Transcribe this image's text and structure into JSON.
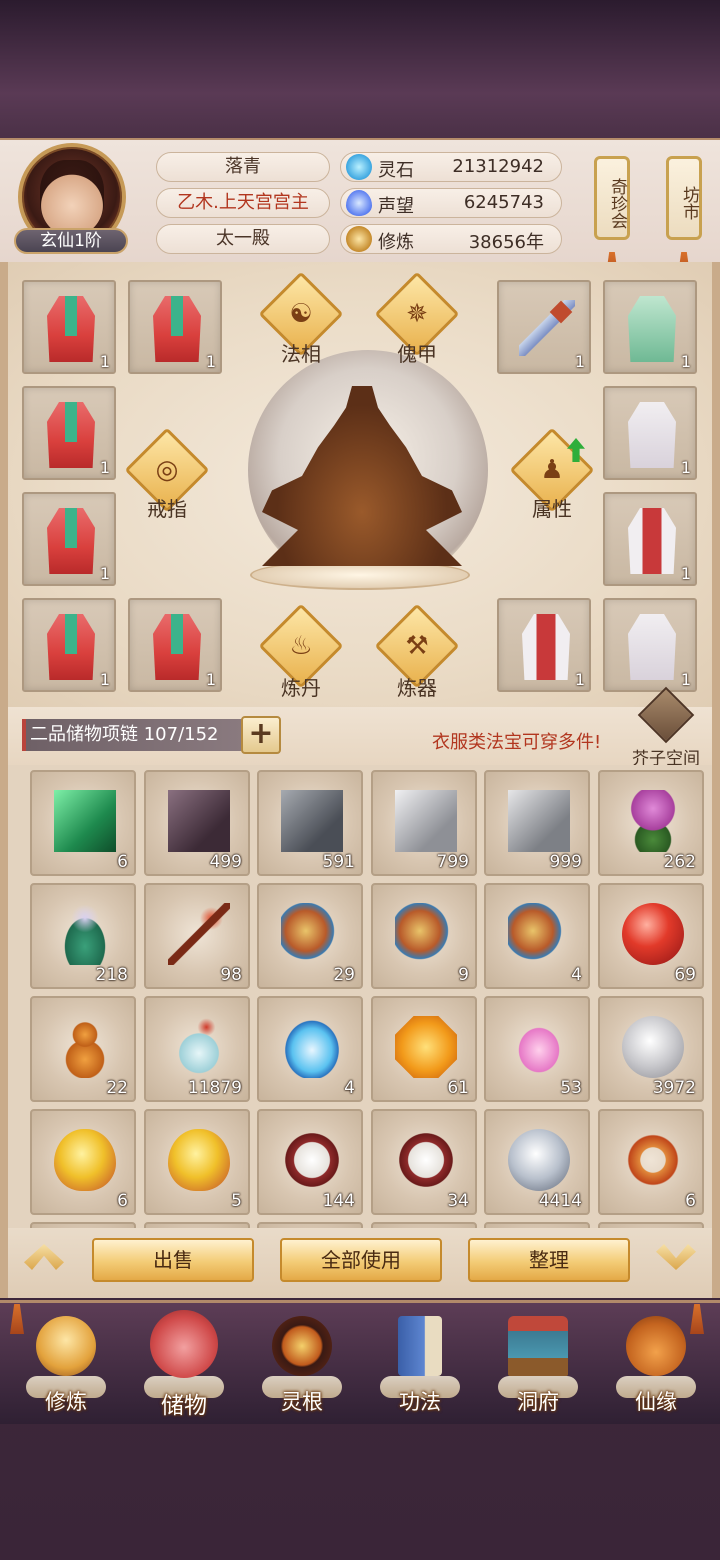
{
  "player": {
    "rank": "玄仙1阶",
    "name": "落青",
    "title": "乙木.上天宫宫主",
    "sect": "太一殿"
  },
  "resources": [
    {
      "icon": "spirit-stone-icon",
      "label": "灵石",
      "value": "21312942"
    },
    {
      "icon": "reputation-icon",
      "label": "声望",
      "value": "6245743"
    },
    {
      "icon": "cultivation-icon",
      "label": "修炼",
      "value": "38656年"
    }
  ],
  "shops": {
    "treasure": "奇珍会",
    "market": "坊市"
  },
  "equipment": {
    "slots": [
      {
        "id": "robe-1",
        "count": "1"
      },
      {
        "id": "robe-2",
        "count": "1"
      },
      {
        "id": "sword",
        "count": "1"
      },
      {
        "id": "green-robe",
        "count": "1"
      },
      {
        "id": "robe-3",
        "count": "1"
      },
      {
        "id": "white-robe-1",
        "count": "1"
      },
      {
        "id": "robe-4",
        "count": "1"
      },
      {
        "id": "mixed-robe-1",
        "count": "1"
      },
      {
        "id": "robe-5",
        "count": "1"
      },
      {
        "id": "robe-6",
        "count": "1"
      },
      {
        "id": "mixed-robe-2",
        "count": "1"
      },
      {
        "id": "white-robe-2",
        "count": "1"
      }
    ],
    "functions": {
      "dharma": "法相",
      "puppet": "傀甲",
      "ring": "戒指",
      "attribute": "属性",
      "alchemy": "炼丹",
      "forge": "炼器"
    }
  },
  "storage": {
    "label": "二品储物项链",
    "capacity": "107/152",
    "plus": "+",
    "hint": "衣服类法宝可穿多件!",
    "space": "芥子空间"
  },
  "inventory": [
    {
      "name": "green-crystal",
      "count": "6"
    },
    {
      "name": "purple-ore",
      "count": "499"
    },
    {
      "name": "dark-ore",
      "count": "591"
    },
    {
      "name": "silver-ore",
      "count": "799"
    },
    {
      "name": "grey-ore",
      "count": "999"
    },
    {
      "name": "purple-herb",
      "count": "262"
    },
    {
      "name": "green-herb",
      "count": "218"
    },
    {
      "name": "red-branch",
      "count": "98"
    },
    {
      "name": "scroll-ornament",
      "count": "29"
    },
    {
      "name": "scroll-ornament",
      "count": "9"
    },
    {
      "name": "scroll-ornament",
      "count": "4"
    },
    {
      "name": "red-orb",
      "count": "69"
    },
    {
      "name": "gourd",
      "count": "22"
    },
    {
      "name": "snow-vase",
      "count": "11879"
    },
    {
      "name": "blue-bowl",
      "count": "4"
    },
    {
      "name": "amber-gem",
      "count": "61"
    },
    {
      "name": "pink-lotus",
      "count": "53"
    },
    {
      "name": "silver-orb",
      "count": "3972"
    },
    {
      "name": "dragon-egg",
      "count": "6"
    },
    {
      "name": "dragon-egg",
      "count": "5"
    },
    {
      "name": "rice-box",
      "count": "144"
    },
    {
      "name": "rice-box",
      "count": "34"
    },
    {
      "name": "silver-pearl",
      "count": "4414"
    },
    {
      "name": "bronze-ring",
      "count": "6"
    }
  ],
  "actions": {
    "sell": "出售",
    "use_all": "全部使用",
    "sort": "整理"
  },
  "nav": [
    {
      "label": "修炼",
      "icon": "cultivate-icon"
    },
    {
      "label": "储物",
      "icon": "storage-bag-icon"
    },
    {
      "label": "灵根",
      "icon": "spirit-root-icon"
    },
    {
      "label": "功法",
      "icon": "technique-book-icon"
    },
    {
      "label": "洞府",
      "icon": "cave-mansion-icon"
    },
    {
      "label": "仙缘",
      "icon": "fortune-gourd-icon"
    }
  ],
  "colors": {
    "accent_red": "#b2361f",
    "gold": "#e4a947",
    "panel": "#eadbc6"
  }
}
